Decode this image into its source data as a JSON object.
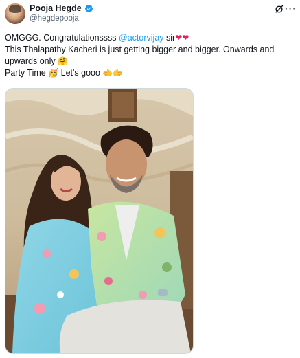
{
  "author": {
    "display_name": "Pooja Hegde",
    "handle": "@hegdepooja",
    "verified_icon": "verified-badge-icon"
  },
  "actions": {
    "grok_icon": "grok-icon",
    "more_label": "···"
  },
  "tweet": {
    "line1_prefix": "OMGGG. Congratulationssss ",
    "mention": "@actorvijay",
    "line1_suffix": " sir",
    "line1_emoji": "❤❤",
    "line2_text": "This Thalapathy Kacheri is just getting bigger and bigger. Onwards and upwards only ",
    "line2_emoji": "🤗",
    "line3_text_a": "Party Time ",
    "line3_emoji_a": "🥳",
    "line3_text_b": " Let's gooo ",
    "line3_emoji_b": "🫲🫱"
  },
  "colors": {
    "accent": "#1d9bf0",
    "text": "#0f1419",
    "secondary": "#536471",
    "heart": "#e0245e"
  }
}
